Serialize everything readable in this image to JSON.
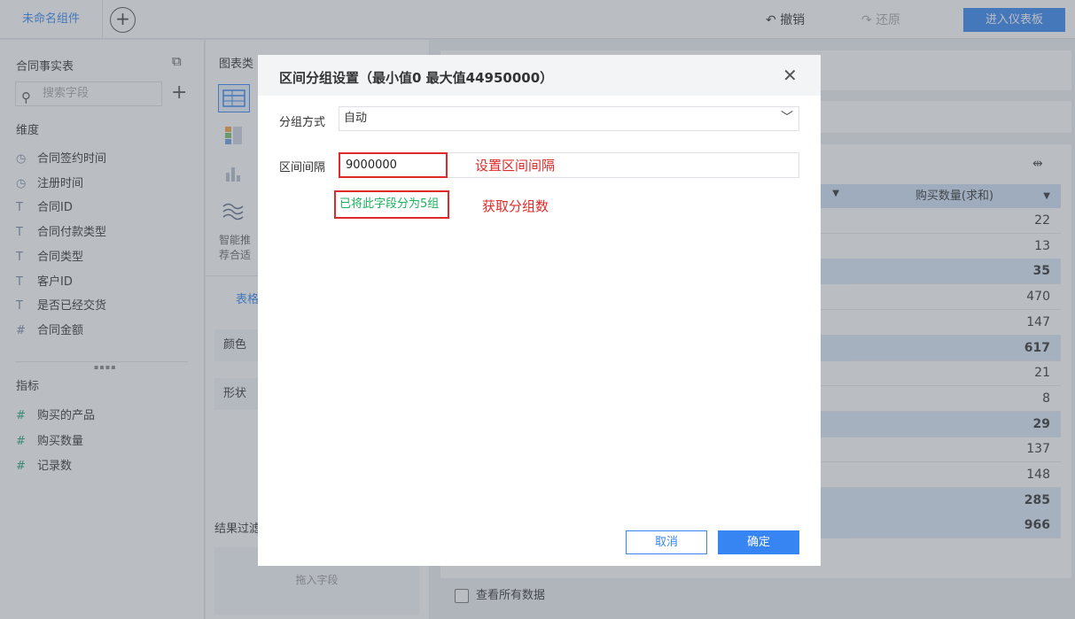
{
  "topbar": {
    "title": "未命名组件",
    "undo": "撤销",
    "redo": "还原",
    "enter_dashboard": "进入仪表板"
  },
  "left_panel": {
    "title": "合同事实表",
    "search_placeholder": "搜索字段",
    "dimensions_label": "维度",
    "dimensions": [
      {
        "icon": "clock-icon",
        "glyph": "◷",
        "label": "合同签约时间"
      },
      {
        "icon": "clock-icon",
        "glyph": "◷",
        "label": "注册时间"
      },
      {
        "icon": "text-type-icon",
        "glyph": "T",
        "label": "合同ID"
      },
      {
        "icon": "text-type-icon",
        "glyph": "T",
        "label": "合同付款类型"
      },
      {
        "icon": "text-type-icon",
        "glyph": "T",
        "label": "合同类型"
      },
      {
        "icon": "text-type-icon",
        "glyph": "T",
        "label": "客户ID"
      },
      {
        "icon": "text-type-icon",
        "glyph": "T",
        "label": "是否已经交货"
      },
      {
        "icon": "number-type-icon",
        "glyph": "#",
        "label": "合同金额"
      }
    ],
    "metrics_label": "指标",
    "metrics": [
      {
        "icon": "number-type-icon",
        "glyph": "#",
        "label": "购买的产品"
      },
      {
        "icon": "number-type-icon",
        "glyph": "#",
        "label": "购买数量"
      },
      {
        "icon": "number-type-icon",
        "glyph": "#",
        "label": "记录数"
      }
    ]
  },
  "middle_panel": {
    "chart_type_label": "图表类",
    "smart_text_1": "智能推",
    "smart_text_2": "荐合适",
    "tab_label": "表格",
    "color_label": "颜色",
    "shape_label": "形状",
    "result_filter_label": "结果过滤",
    "drop_placeholder": "拖入字段"
  },
  "table": {
    "column_header": "购买数量(求和)",
    "values": [
      "22",
      "13",
      "35",
      "470",
      "147",
      "617",
      "21",
      "8",
      "29",
      "137",
      "148",
      "285",
      "966"
    ],
    "bold_rows": [
      2,
      5,
      8,
      11,
      12
    ],
    "show_all_label": "查看所有数据"
  },
  "modal": {
    "title": "区间分组设置（最小值0 最大值44950000）",
    "group_mode_label": "分组方式",
    "group_mode_value": "自动",
    "interval_label": "区间间隔",
    "interval_value": "9000000",
    "interval_annotation": "设置区间间隔",
    "group_result": "已将此字段分为5组",
    "group_result_annotation": "获取分组数",
    "cancel_label": "取消",
    "ok_label": "确定"
  },
  "colors": {
    "primary": "#3685f2",
    "annotation_red": "#e02a2a",
    "success_green": "#19b35e"
  }
}
